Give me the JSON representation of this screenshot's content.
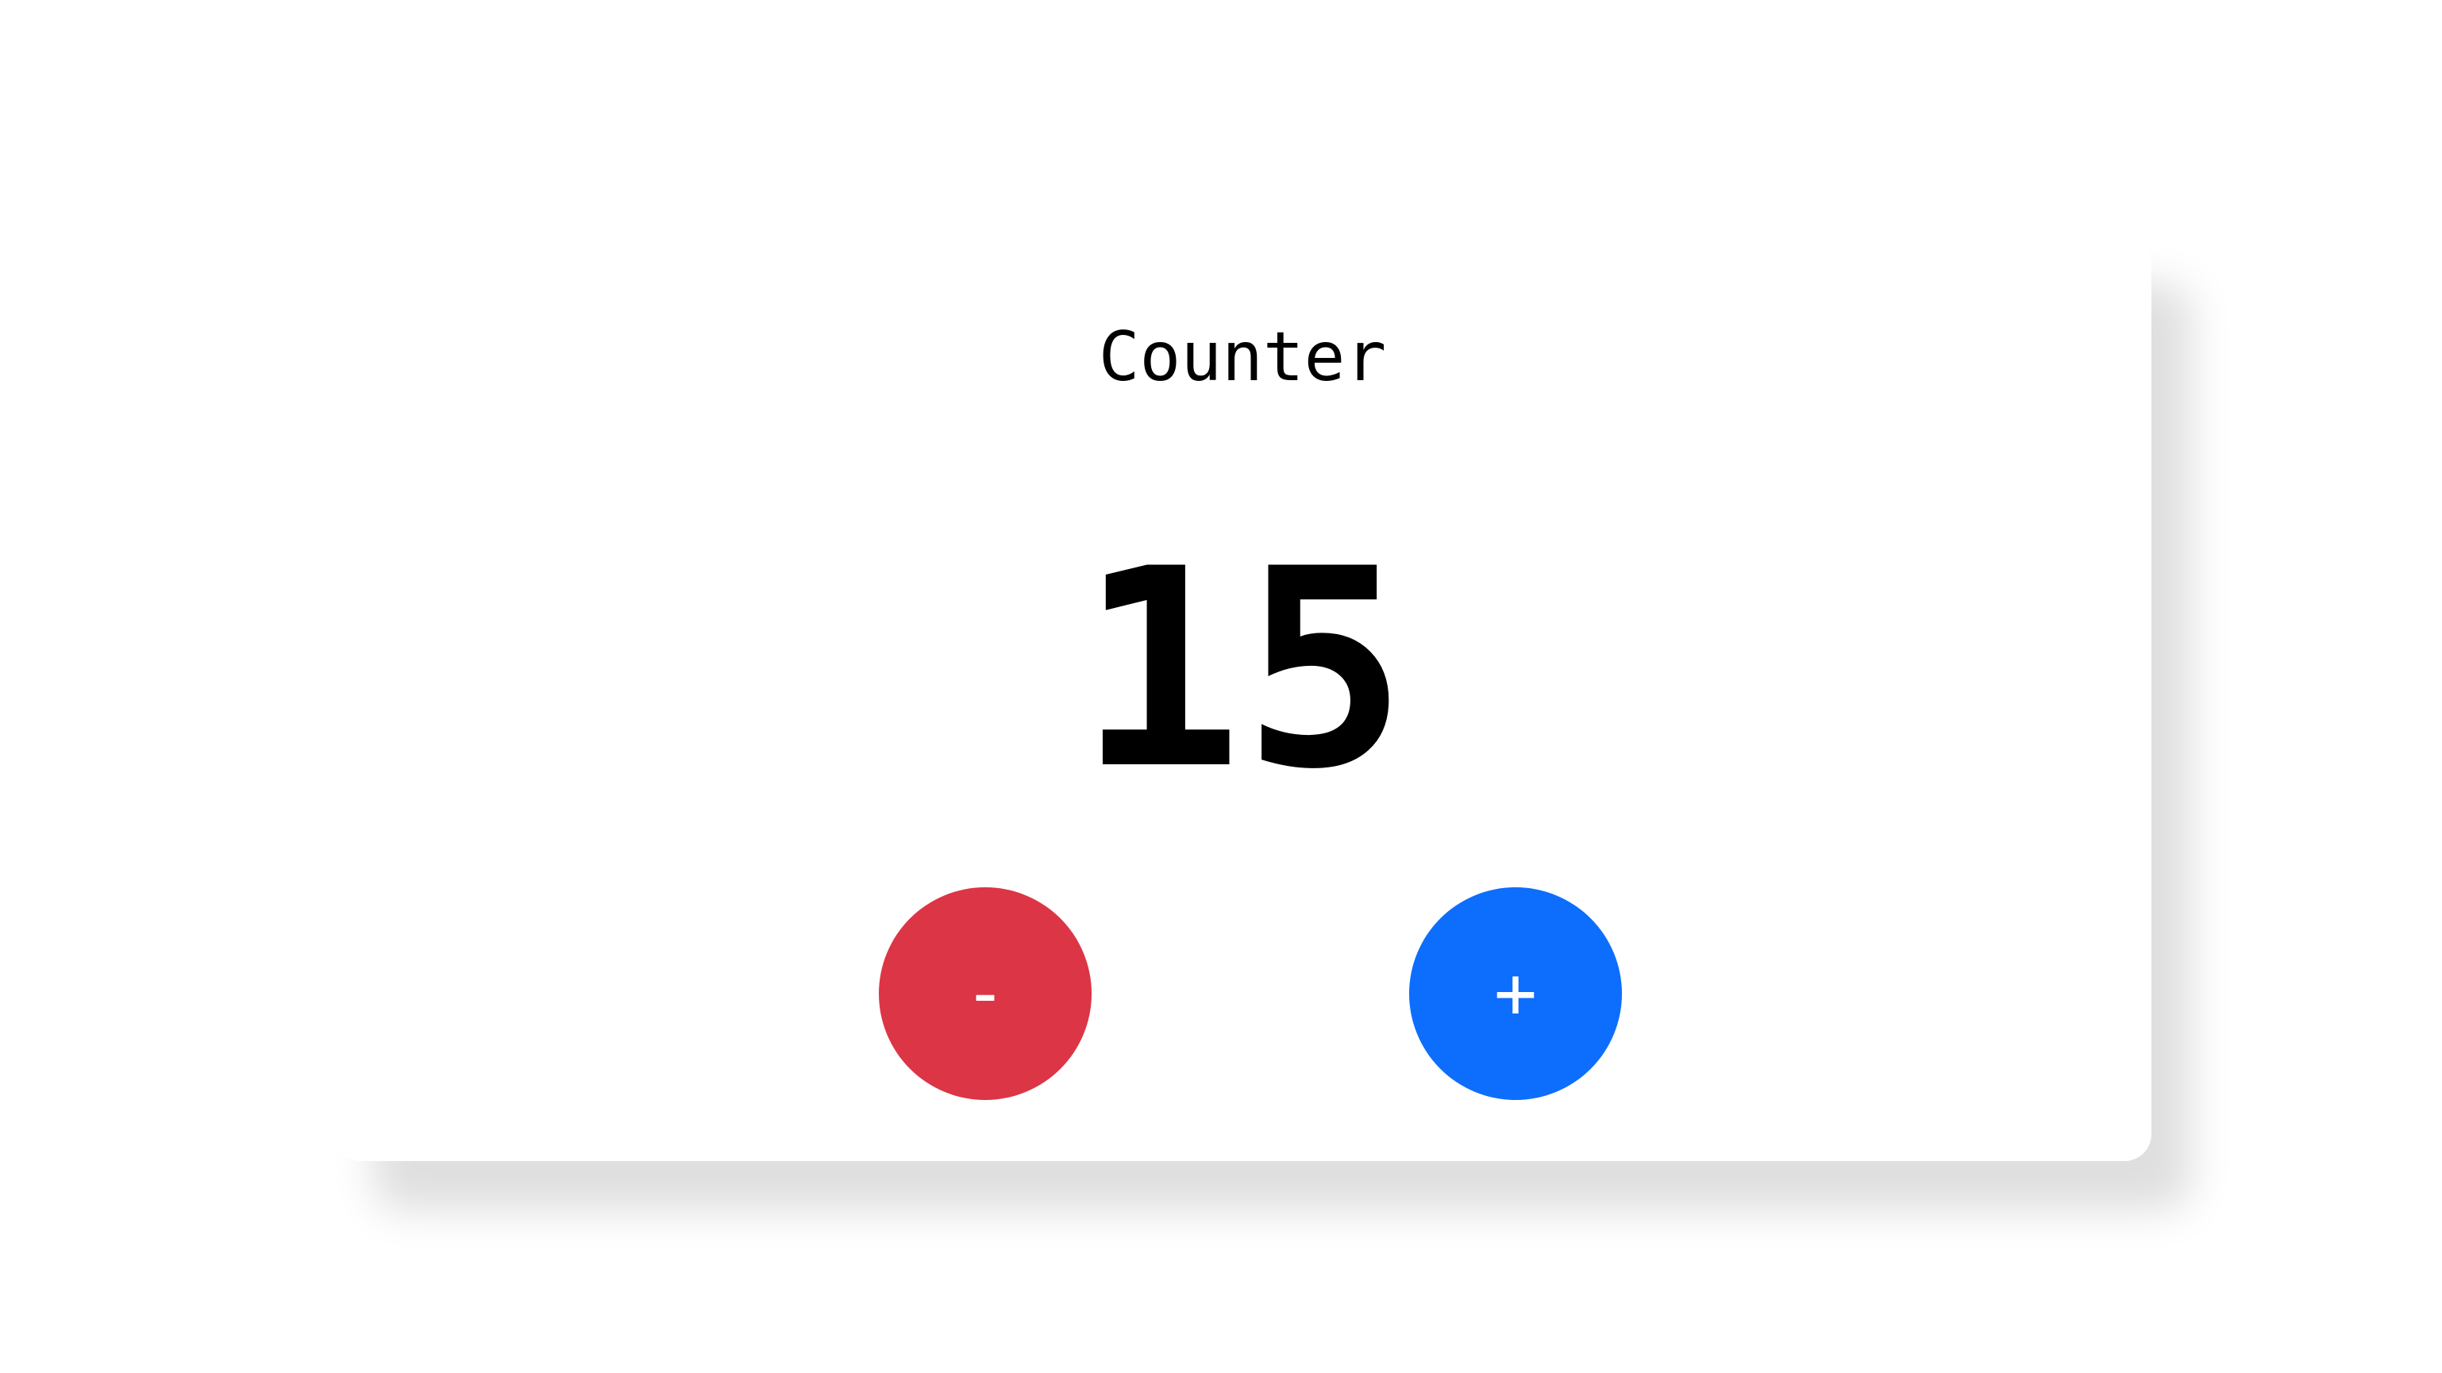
{
  "counter": {
    "title": "Counter",
    "value": "15",
    "decrement_label": "-",
    "increment_label": "+"
  },
  "colors": {
    "decrement": "#dc3545",
    "increment": "#0d6efd",
    "card_background": "#ffffff",
    "text": "#000000"
  }
}
